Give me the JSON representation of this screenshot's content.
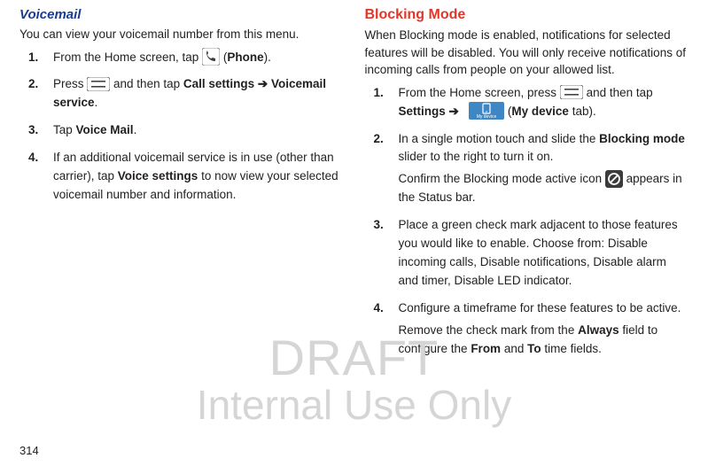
{
  "left": {
    "heading": "Voicemail",
    "intro": "You can view your voicemail number from this menu.",
    "steps": [
      {
        "num": "1.",
        "pre": "From the Home screen, tap ",
        "post": " (",
        "bold1": "Phone",
        "tail": ")."
      },
      {
        "num": "2.",
        "pre": "Press ",
        "post": " and then tap ",
        "bold1": "Call settings ➔ Voicemail service",
        "tail": "."
      },
      {
        "num": "3.",
        "pre": "Tap ",
        "bold1": "Voice Mail",
        "tail": "."
      },
      {
        "num": "4.",
        "pre": "If an additional voicemail service is in use (other than carrier), tap ",
        "bold1": "Voice settings",
        "post": " to now view your selected voicemail number and information."
      }
    ]
  },
  "right": {
    "heading": "Blocking Mode",
    "intro": "When Blocking mode is enabled, notifications for selected features will be disabled. You will only receive notifications of incoming calls from people on your allowed list.",
    "steps": [
      {
        "num": "1.",
        "pre": "From the Home screen, press ",
        "mid1": " and then tap ",
        "bold1": "Settings ➔",
        "mid2": " (",
        "bold2": "My device",
        "tail": " tab).",
        "tabLabel": "My device"
      },
      {
        "num": "2.",
        "line1_pre": "In a single motion touch and slide the ",
        "line1_bold": "Blocking mode",
        "line1_post": " slider to the right to turn it on.",
        "line2_pre": "Confirm the Blocking mode active icon ",
        "line2_post": " appears in the Status bar."
      },
      {
        "num": "3.",
        "text": "Place a green check mark adjacent to those features you would like to enable. Choose from: Disable incoming calls, Disable notifications, Disable alarm and timer, Disable LED indicator."
      },
      {
        "num": "4.",
        "line1": "Configure a timeframe for these features to be active.",
        "line2_pre": "Remove the check mark from the ",
        "line2_bold1": "Always",
        "line2_mid": " field to configure the ",
        "line2_bold2": "From",
        "line2_mid2": " and ",
        "line2_bold3": "To",
        "line2_tail": " time fields."
      }
    ]
  },
  "watermark": {
    "line1": "DRAFT",
    "line2": "Internal Use Only"
  },
  "pageNumber": "314"
}
